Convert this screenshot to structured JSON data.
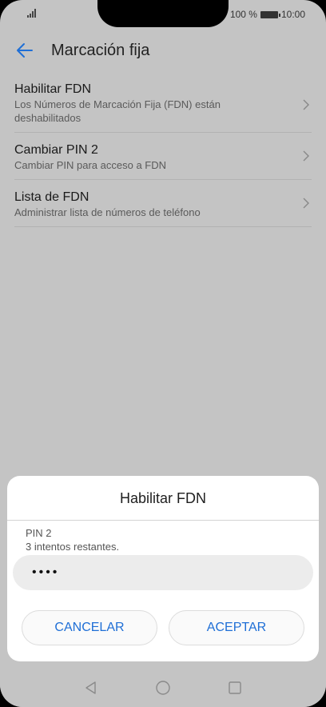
{
  "status": {
    "battery_percent": "100 %",
    "time": "10:00"
  },
  "appbar": {
    "title": "Marcación fija",
    "back_icon": "arrow-left-icon"
  },
  "settings": [
    {
      "title": "Habilitar FDN",
      "subtitle": "Los Números de Marcación Fija (FDN) están deshabilitados"
    },
    {
      "title": "Cambiar PIN 2",
      "subtitle": "Cambiar PIN para acceso a FDN"
    },
    {
      "title": "Lista de FDN",
      "subtitle": "Administrar lista de números de teléfono"
    }
  ],
  "dialog": {
    "title": "Habilitar FDN",
    "field_label": "PIN 2",
    "field_hint": "3 intentos restantes.",
    "pin_value": "••••",
    "cancel_label": "CANCELAR",
    "ok_label": "ACEPTAR"
  },
  "navbar": {
    "icons": [
      "back-triangle-icon",
      "home-circle-icon",
      "recents-square-icon"
    ]
  },
  "colors": {
    "accent": "#1f6fd6",
    "background": "#c4c4c4",
    "dialog": "#ffffff"
  }
}
